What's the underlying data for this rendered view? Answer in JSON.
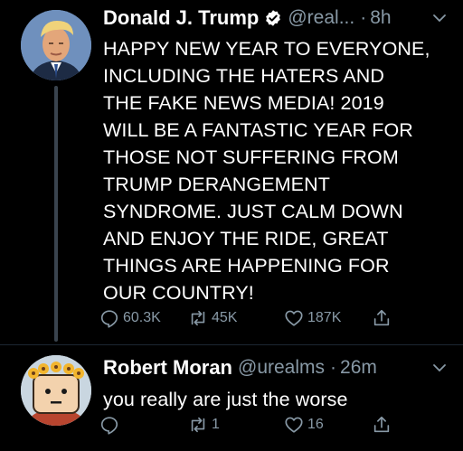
{
  "colors": {
    "background": "#000000",
    "text": "#ffffff",
    "secondary": "#8899a6",
    "thread_line": "#3a444e",
    "verified": "#ffffff"
  },
  "tweets": [
    {
      "name": "Donald J. Trump",
      "verified": true,
      "handle": "@real...",
      "separator": "·",
      "time": "8h",
      "text": "HAPPY NEW YEAR TO EVERYONE,\nINCLUDING THE HATERS AND\nTHE FAKE NEWS MEDIA! 2019\nWILL BE A FANTASTIC YEAR FOR\nTHOSE NOT SUFFERING FROM\nTRUMP DERANGEMENT\nSYNDROME. JUST CALM DOWN\nAND ENJOY THE RIDE, GREAT\nTHINGS ARE HAPPENING FOR\nOUR COUNTRY!",
      "actions": {
        "replies": "60.3K",
        "retweets": "45K",
        "likes": "187K"
      }
    },
    {
      "name": "Robert Moran",
      "verified": false,
      "handle": "@urealms",
      "separator": "·",
      "time": "26m",
      "text": "you really are just the worse",
      "actions": {
        "replies": "",
        "retweets": "1",
        "likes": "16"
      }
    }
  ],
  "icons": {
    "verified": "verified-badge-icon",
    "chevron": "chevron-down-icon",
    "reply": "reply-icon",
    "retweet": "retweet-icon",
    "like": "heart-icon",
    "share": "share-icon"
  }
}
